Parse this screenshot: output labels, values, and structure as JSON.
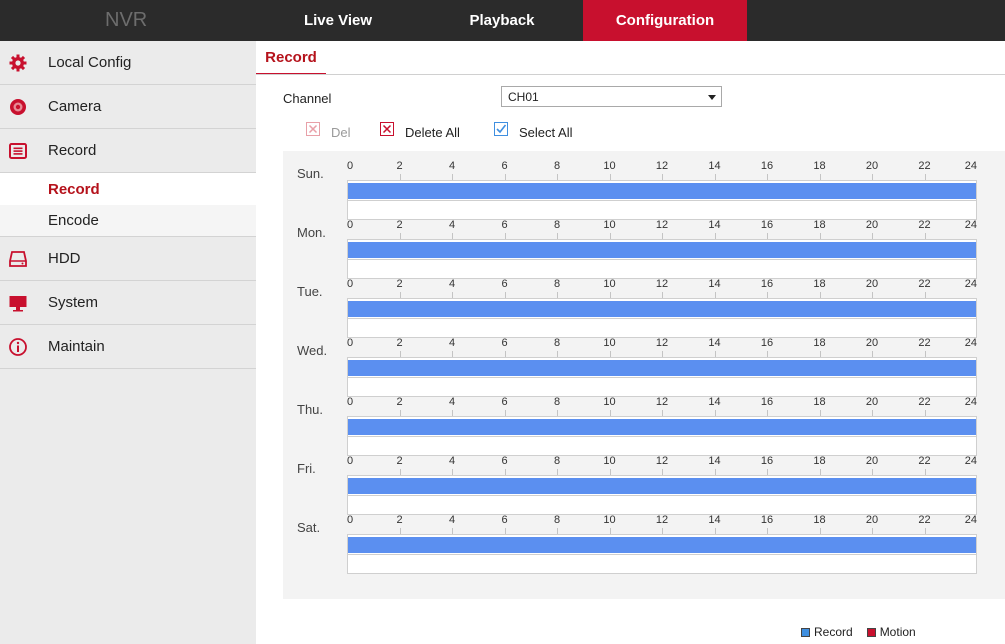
{
  "brand": "NVR",
  "nav": {
    "tabs": [
      {
        "label": "Live View",
        "active": false
      },
      {
        "label": "Playback",
        "active": false
      },
      {
        "label": "Configuration",
        "active": true
      }
    ]
  },
  "sidebar": {
    "items": [
      {
        "label": "Local Config",
        "icon": "gear-icon"
      },
      {
        "label": "Camera",
        "icon": "camera-icon"
      },
      {
        "label": "Record",
        "icon": "record-icon"
      },
      {
        "label": "HDD",
        "icon": "hdd-icon"
      },
      {
        "label": "System",
        "icon": "monitor-icon"
      },
      {
        "label": "Maintain",
        "icon": "info-icon"
      }
    ],
    "record_subitems": [
      {
        "label": "Record",
        "active": true
      },
      {
        "label": "Encode",
        "active": false
      }
    ]
  },
  "main": {
    "page_tab": "Record",
    "channel_label": "Channel",
    "channel_value": "CH01",
    "toolbar": {
      "del_label": "Del",
      "delete_all_label": "Delete All",
      "select_all_label": "Select All"
    },
    "schedule": {
      "ticks": [
        "0",
        "2",
        "4",
        "6",
        "8",
        "10",
        "12",
        "14",
        "16",
        "18",
        "20",
        "22",
        "24"
      ],
      "days": [
        {
          "label": "Sun.",
          "record_from_hour": 0,
          "record_to_hour": 24
        },
        {
          "label": "Mon.",
          "record_from_hour": 0,
          "record_to_hour": 24
        },
        {
          "label": "Tue.",
          "record_from_hour": 0,
          "record_to_hour": 24
        },
        {
          "label": "Wed.",
          "record_from_hour": 0,
          "record_to_hour": 24
        },
        {
          "label": "Thu.",
          "record_from_hour": 0,
          "record_to_hour": 24
        },
        {
          "label": "Fri.",
          "record_from_hour": 0,
          "record_to_hour": 24
        },
        {
          "label": "Sat.",
          "record_from_hour": 0,
          "record_to_hour": 24
        }
      ]
    },
    "legend": [
      {
        "label": "Record",
        "color": "#3f8fe0"
      },
      {
        "label": "Motion",
        "color": "#c8102e"
      }
    ]
  },
  "colors": {
    "accent": "#c8102e",
    "topbar": "#2b2b2b",
    "record_fill": "#5b8ff0"
  }
}
